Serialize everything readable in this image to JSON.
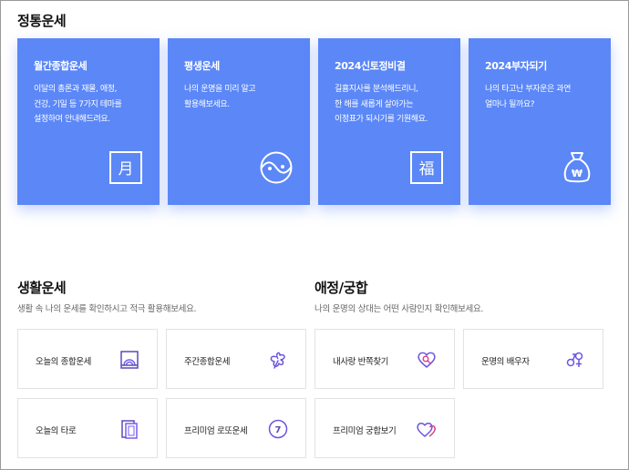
{
  "fortune": {
    "title": "정통운세",
    "cards": [
      {
        "title": "월간종합운세",
        "desc": "이달의 총론과 재물, 애정,\n건강, 기일 등 7가지 테마를\n설정하여 안내해드려요.",
        "icon": "calendar-month-icon",
        "icon_text": "月"
      },
      {
        "title": "평생운세",
        "desc": "나의 운명을 미리 알고\n활용해보세요.",
        "icon": "yin-yang-icon"
      },
      {
        "title": "2024신토정비결",
        "desc": "길흉지사를 분석해드리니,\n한 해를 새롭게 살아가는\n이정표가 되시기를 기원해요.",
        "icon": "fortune-bok-icon",
        "icon_text": "福"
      },
      {
        "title": "2024부자되기",
        "desc": "나의 타고난 부자운은 과연\n얼마나 될까요?",
        "icon": "money-bag-icon",
        "icon_text": "₩"
      }
    ]
  },
  "life": {
    "title": "생활운세",
    "subtitle": "생활 속 나의 운세를 확인하시고 적극 활용해보세요.",
    "items": [
      {
        "label": "오늘의 종합운세",
        "icon": "sunrise-frame-icon"
      },
      {
        "label": "주간종합운세",
        "icon": "clover-icon"
      },
      {
        "label": "오늘의 타로",
        "icon": "tarot-cards-icon"
      },
      {
        "label": "프리미엄 로또운세",
        "icon": "lotto-ball-icon",
        "icon_text": "7"
      }
    ]
  },
  "love": {
    "title": "애정/궁합",
    "subtitle": "나의 운명의 상대는 어떤 사람인지 확인해보세요.",
    "items": [
      {
        "label": "내사랑 반쪽찾기",
        "icon": "heart-search-icon"
      },
      {
        "label": "운명의 배우자",
        "icon": "gender-couple-icon"
      },
      {
        "label": "프리미엄 궁합보기",
        "icon": "double-heart-icon"
      }
    ]
  },
  "colors": {
    "card_bg": "#5b87f7",
    "accent_icon": "#6a56e0",
    "tile_border": "#e2e2e2"
  }
}
